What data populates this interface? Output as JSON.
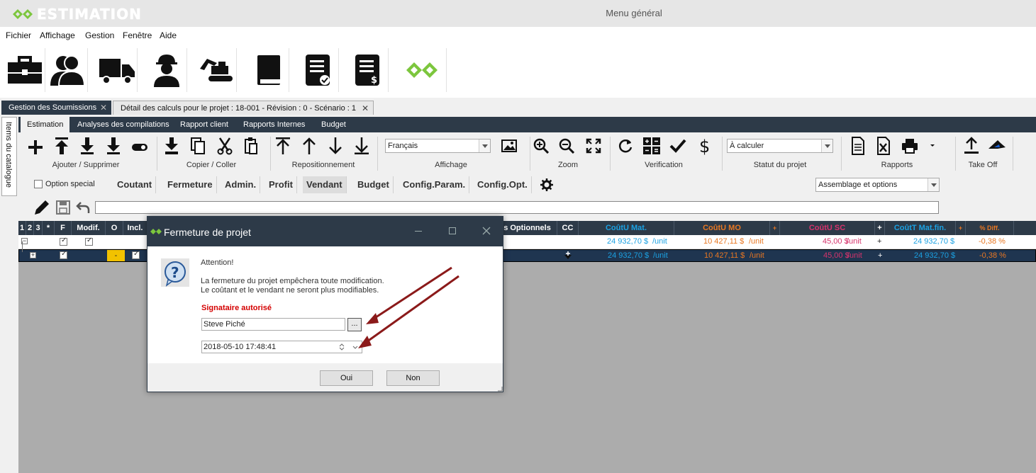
{
  "app": {
    "logo_text": "ESTIMATION",
    "window_title": "Menu général"
  },
  "menu": {
    "items": [
      {
        "label": "Fichier"
      },
      {
        "label": "Affichage"
      },
      {
        "label": "Gestion"
      },
      {
        "label": "Fenêtre"
      },
      {
        "label": "Aide"
      }
    ]
  },
  "doc_tabs": [
    {
      "label": "Gestion des Soumissions",
      "close": "✕"
    },
    {
      "label": "Détail des calculs pour le projet : 18-001 - Révision : 0 - Scénario : 1",
      "close": "✕"
    }
  ],
  "side_tab": {
    "label": "Items du catalogue"
  },
  "ribbon_tabs": [
    {
      "label": "Estimation"
    },
    {
      "label": "Analyses des compilations"
    },
    {
      "label": "Rapport client"
    },
    {
      "label": "Rapports Internes"
    },
    {
      "label": "Budget"
    }
  ],
  "ribbon_groups": {
    "add_remove": "Ajouter / Supprimer",
    "copy_paste": "Copier / Coller",
    "reposition": "Repositionnement",
    "display": "Affichage",
    "zoom": "Zoom",
    "verification": "Verification",
    "status": "Statut du projet",
    "reports": "Rapports",
    "takeoff": "Take Off"
  },
  "language_combo": {
    "value": "Français"
  },
  "status_combo": {
    "value": "À calculer"
  },
  "option_special": {
    "label": "Option special",
    "checked": false
  },
  "view_tabs": [
    {
      "label": "Coutant"
    },
    {
      "label": "Fermeture"
    },
    {
      "label": "Admin."
    },
    {
      "label": "Profit"
    },
    {
      "label": "Vendant"
    },
    {
      "label": "Budget"
    },
    {
      "label": "Config.Param."
    },
    {
      "label": "Config.Opt."
    }
  ],
  "assembly_combo": {
    "value": "Assemblage et options"
  },
  "grid": {
    "headers": {
      "c1": "1",
      "c2": "2",
      "c3": "3",
      "c4": "*",
      "f": "F",
      "modif": "Modif.",
      "o": "O",
      "incl": "Incl.",
      "opt": "s Optionnels",
      "cc": "CC",
      "mat": "CoûtU Mat.",
      "mo": "CoûtU MO",
      "plus1": "+",
      "sc": "CoûtU SC",
      "plus2": "+",
      "matfin": "CoûtT Mat.fin.",
      "plus3": "+",
      "diff": "% Diff."
    },
    "rows": [
      {
        "expand": "−",
        "mat": "24 932,70 $",
        "mat_unit": "/unit",
        "mo": "10 427,11 $",
        "mo_unit": "/unit",
        "sc": "45,00 $",
        "sc_unit": "/unit",
        "plus": "+",
        "matfin": "24 932,70 $",
        "diff": "-0,38 %"
      },
      {
        "expand": "+",
        "o_value": "-",
        "mat": "24 932,70 $",
        "mat_unit": "/unit",
        "mo": "10 427,11 $",
        "mo_unit": "/unit",
        "sc": "45,00 $",
        "sc_unit": "/unit",
        "plus": "+",
        "matfin": "24 932,70 $",
        "diff": "-0,38 %"
      }
    ]
  },
  "dialog": {
    "title": "Fermeture de projet",
    "heading": "Attention!",
    "message1": "La fermeture du projet empêchera toute modification.",
    "message2": "Le coûtant et le vendant ne seront plus modifiables.",
    "signatory_label": "Signataire autorisé",
    "signatory_value": "Steve Piché",
    "browse_label": "...",
    "datetime_value": "2018-05-10 17:48:41",
    "yes_label": "Oui",
    "no_label": "Non"
  },
  "colors": {
    "dark": "#2d3a48",
    "green": "#7cc63d",
    "mat": "#1ba1e2",
    "mo": "#e87722",
    "sc": "#d6336c",
    "red_label": "#d40000",
    "arrow": "#8b1a1a"
  }
}
